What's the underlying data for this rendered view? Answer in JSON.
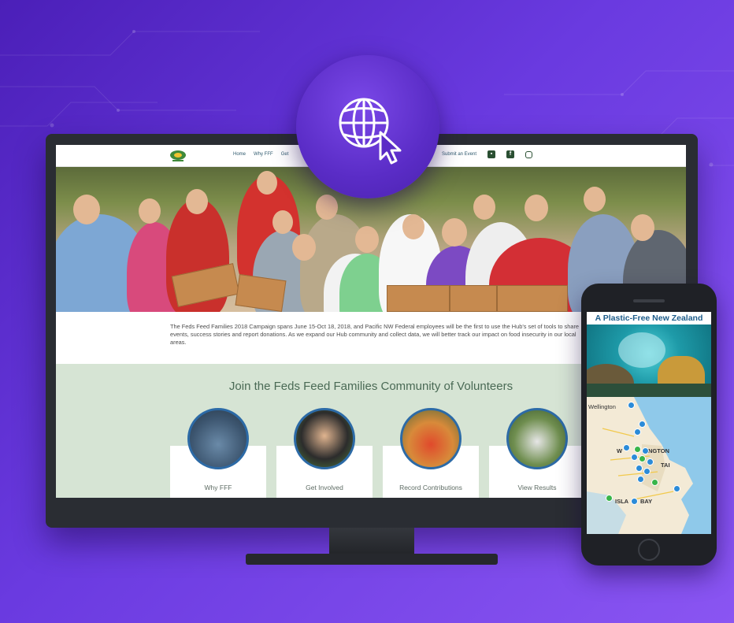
{
  "site": {
    "nav": {
      "links": [
        "Home",
        "Why FFF",
        "Get"
      ],
      "submit_event": "Submit an Event"
    },
    "intro_text": "The Feds Feed Families 2018 Campaign spans June 15-Oct 18, 2018, and Pacific NW Federal employees will be the first to use the Hub's set of tools to share events, success stories and report donations. As we expand our Hub community and collect data, we will better track our impact on food insecurity in our local areas.",
    "community": {
      "heading": "Join the Feds Feed Families Community of Volunteers",
      "cards": [
        {
          "label": "Why FFF"
        },
        {
          "label": "Get Involved"
        },
        {
          "label": "Record Contributions"
        },
        {
          "label": "View Results"
        }
      ]
    }
  },
  "phone": {
    "title": "A Plastic-Free New Zealand",
    "map_labels": [
      "Wellington",
      "W",
      "NGTON",
      "ISLA",
      "BAY",
      "TAI"
    ]
  },
  "icons": {
    "badge": "globe-cursor-icon",
    "social": [
      "twitter-icon",
      "facebook-icon",
      "instagram-icon"
    ]
  },
  "colors": {
    "background": "#6a3ae0",
    "community_band": "#d6e4d4",
    "card_ring": "#2c6aa6",
    "phone_title": "#1d5c8a"
  }
}
